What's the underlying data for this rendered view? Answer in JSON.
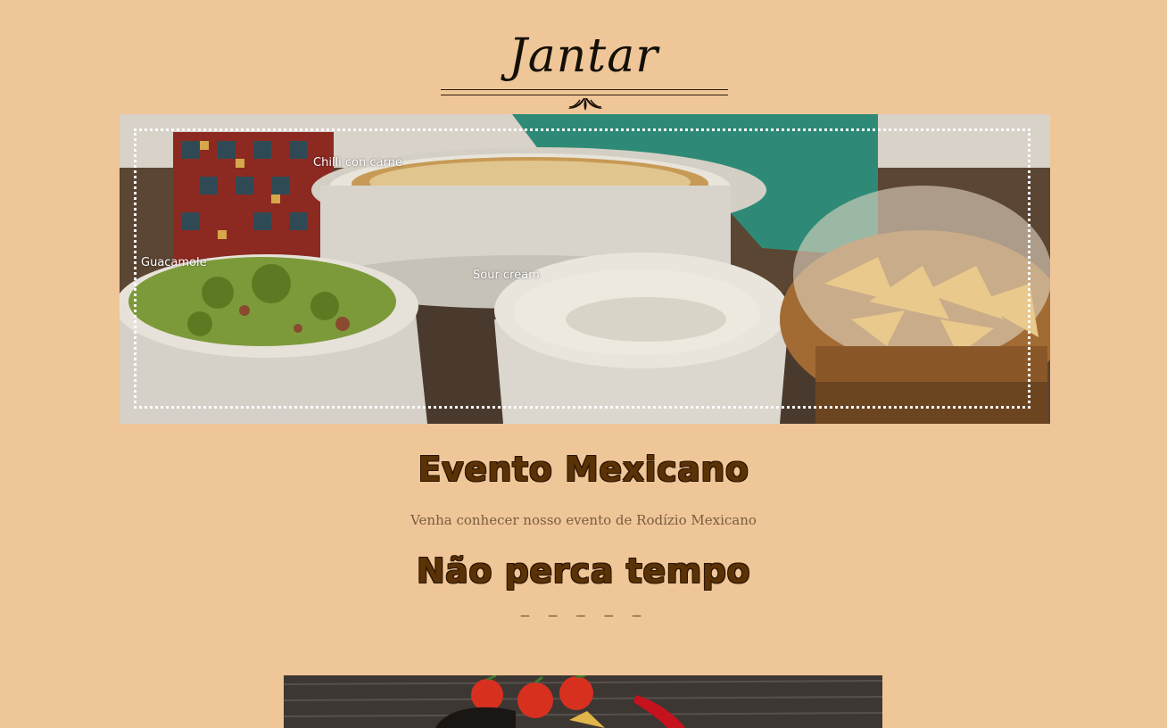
{
  "header": {
    "logo_text": "Jantar"
  },
  "hero": {
    "labels": {
      "chilli": "Chilli con carne",
      "guacamole": "Guacamole",
      "sour_cream": "Sour cream"
    }
  },
  "event": {
    "title": "Evento Mexicano",
    "subtitle": "Venha conhecer nosso evento de Rodízio Mexicano",
    "cta_title": "Não perca tempo",
    "dashes": "– – – – –"
  },
  "colors": {
    "background": "#efc698",
    "title": "#5a3206",
    "subtitle": "#7a5c3f"
  }
}
